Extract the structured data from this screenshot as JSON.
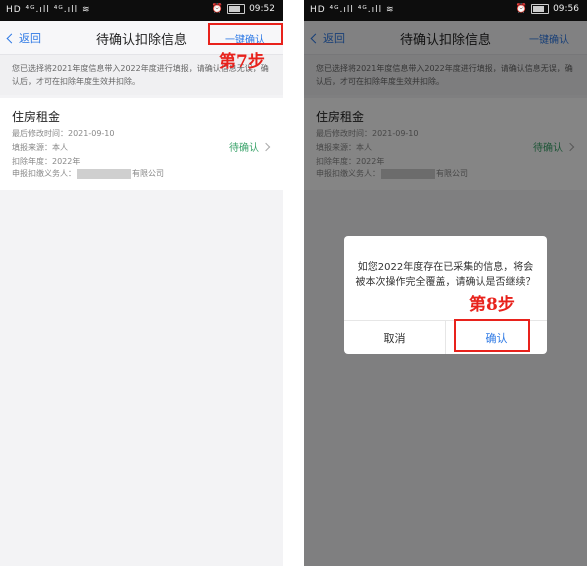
{
  "left": {
    "statusbar": {
      "signal": "HD ⁴ᴳ.ıll ⁴ᴳ.ıll ≋",
      "time": "09:52"
    },
    "nav": {
      "back_label": "返回",
      "title": "待确认扣除信息",
      "action_label": "一键确认"
    },
    "notice": "您已选择将2021年度信息带入2022年度进行填报，请确认信息无误，确认后，才可在扣除年度生效并扣除。",
    "card": {
      "title": "住房租金",
      "modified": "最后修改时间：2021-09-10",
      "source": "填报来源：本人",
      "year": "扣除年度：2022年",
      "agent_prefix": "申报扣缴义务人：",
      "agent_suffix": "有限公司",
      "status": "待确认"
    },
    "step_label": "第7步"
  },
  "right": {
    "statusbar": {
      "signal": "HD ⁴ᴳ.ıll ⁴ᴳ.ıll ≋",
      "time": "09:56"
    },
    "nav": {
      "back_label": "返回",
      "title": "待确认扣除信息",
      "action_label": "一键确认"
    },
    "notice": "您已选择将2021年度信息带入2022年度进行填报，请确认信息无误，确认后，才可在扣除年度生效并扣除。",
    "card": {
      "title": "住房租金",
      "modified": "最后修改时间：2021-09-10",
      "source": "填报来源：本人",
      "year": "扣除年度：2022年",
      "agent_prefix": "申报扣缴义务人：",
      "agent_suffix": "有限公司",
      "status": "待确认"
    },
    "dialog": {
      "message": "如您2022年度存在已采集的信息，将会被本次操作完全覆盖，请确认是否继续？",
      "cancel_label": "取消",
      "ok_label": "确认"
    },
    "step_label": "第8步"
  },
  "colors": {
    "accent": "#2f7ae5",
    "pending": "#3aa36a",
    "annotation": "#e8221c"
  }
}
